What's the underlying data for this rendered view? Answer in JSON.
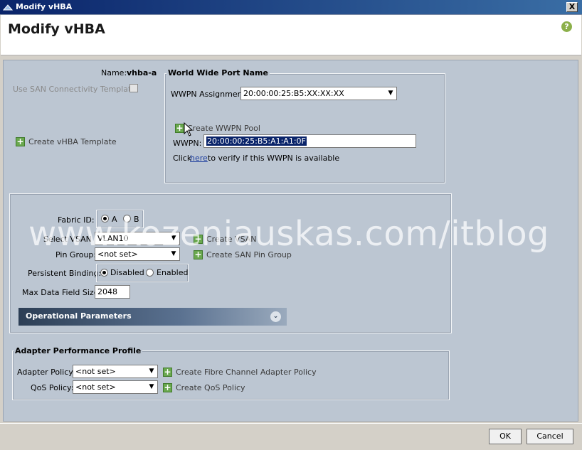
{
  "window": {
    "title": "Modify vHBA",
    "close_glyph": "X",
    "header_title": "Modify vHBA",
    "help_glyph": "?"
  },
  "top": {
    "name_label": "Name:",
    "name_value": "vhba-a",
    "use_template_label": "Use SAN Connectivity Template:",
    "use_template_checked": false,
    "create_vhba_template": "Create vHBA Template"
  },
  "wwpn_group": {
    "title": "World Wide Port Name",
    "assignment_label": "WWPN Assignment:",
    "assignment_value": "20:00:00:25:B5:XX:XX:XX",
    "create_pool": "Create WWPN Pool",
    "wwpn_label": "WWPN:",
    "wwpn_value": "20:00:00:25:B5:A1:A1:0F",
    "verify_prefix": "Click",
    "verify_link": "here",
    "verify_suffix": "to verify if this WWPN is available"
  },
  "fabric": {
    "fabric_label": "Fabric ID:",
    "fabric_options": [
      "A",
      "B"
    ],
    "fabric_selected": "A",
    "vsan_label": "Select VSAN",
    "vsan_value": "VLAN10",
    "create_vsan": "Create VSAN",
    "pin_label": "Pin Group:",
    "pin_value": "<not set>",
    "create_pin": "Create SAN Pin Group",
    "persist_label": "Persistent Binding:",
    "persist_options": [
      "Disabled",
      "Enabled"
    ],
    "persist_selected": "Disabled",
    "maxsize_label": "Max Data Field Size:",
    "maxsize_value": "2048",
    "oper_params": "Operational Parameters"
  },
  "adapter": {
    "title": "Adapter Performance Profile",
    "adapter_label": "Adapter Policy:",
    "adapter_value": "<not set>",
    "create_adapter": "Create Fibre Channel Adapter Policy",
    "qos_label": "QoS Policy:",
    "qos_value": "<not set>",
    "create_qos": "Create QoS Policy"
  },
  "footer": {
    "ok": "OK",
    "cancel": "Cancel"
  },
  "watermark": "www.kozeniauskas.com/itblog",
  "colors": {
    "title_bar": "#0a246a",
    "content_bg": "#bcc6d2",
    "plus_green": "#6aa84f",
    "selection_blue": "#0a246a"
  },
  "icons": [
    "window-icon",
    "close-icon",
    "help-icon",
    "plus-icon",
    "chevron-down-icon",
    "expand-icon",
    "mouse-cursor-icon"
  ]
}
